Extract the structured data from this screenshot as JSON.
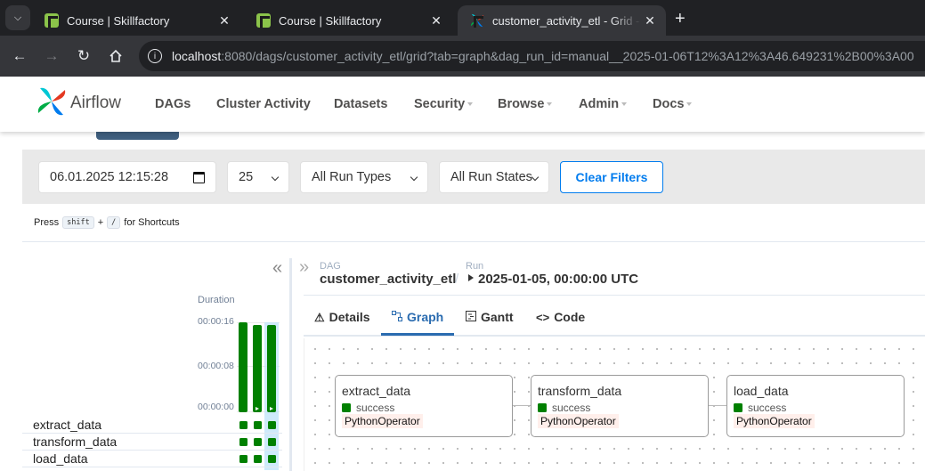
{
  "browser": {
    "tabs": [
      {
        "title": "Course | Skillfactory",
        "favicon": "skillfactory-icon"
      },
      {
        "title": "Course | Skillfactory",
        "favicon": "skillfactory-icon"
      },
      {
        "title": "customer_activity_etl - Grid - Airflow",
        "favicon": "airflow-icon"
      }
    ],
    "url_host": "localhost",
    "url_rest": ":8080/dags/customer_activity_etl/grid?tab=graph&dag_run_id=manual__2025-01-06T12%3A12%3A46.649231%2B00%3A00"
  },
  "nav": {
    "brand": "Airflow",
    "items": [
      "DAGs",
      "Cluster Activity",
      "Datasets",
      "Security",
      "Browse",
      "Admin",
      "Docs"
    ]
  },
  "filters": {
    "date": "06.01.2025 12:15:28",
    "num_runs": "25",
    "run_types": "All Run Types",
    "run_states": "All Run States",
    "clear": "Clear Filters"
  },
  "shortcuts": {
    "press": "Press",
    "key1": "shift",
    "plus": "+",
    "key2": "/",
    "suffix": "for Shortcuts"
  },
  "grid": {
    "duration_label": "Duration",
    "ticks": [
      "00:00:16",
      "00:00:08",
      "00:00:00"
    ],
    "run_durations_seconds": [
      16,
      15.5,
      15.5
    ],
    "tasks": [
      "extract_data",
      "transform_data",
      "load_data"
    ],
    "status_color": "#008000"
  },
  "details": {
    "dag_label": "DAG",
    "dag_id": "customer_activity_etl",
    "run_label": "Run",
    "run_id": "2025-01-05, 00:00:00 UTC",
    "tabs": [
      "Details",
      "Graph",
      "Gantt",
      "Code"
    ],
    "active_tab": "Graph"
  },
  "graph": {
    "nodes": [
      {
        "name": "extract_data",
        "state": "success",
        "operator": "PythonOperator"
      },
      {
        "name": "transform_data",
        "state": "success",
        "operator": "PythonOperator"
      },
      {
        "name": "load_data",
        "state": "success",
        "operator": "PythonOperator"
      }
    ]
  }
}
